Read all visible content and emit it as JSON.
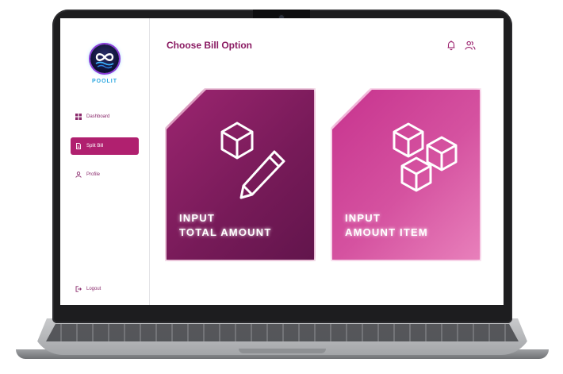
{
  "app": {
    "logo_text": "POOLIT",
    "page_title": "Choose Bill Option"
  },
  "sidebar": {
    "items": [
      {
        "label": "Dashboard",
        "icon": "dashboard-icon"
      },
      {
        "label": "Split Bill",
        "icon": "document-icon",
        "active": true
      },
      {
        "label": "Profile",
        "icon": "user-icon"
      }
    ],
    "logout_label": "Logout"
  },
  "header": {
    "icons": [
      "bell-icon",
      "users-icon"
    ]
  },
  "cards": [
    {
      "line1": "INPUT",
      "line2": "TOTAL AMOUNT",
      "icon": "box-pencil-icon"
    },
    {
      "line1": "INPUT",
      "line2": "AMOUNT ITEM",
      "icon": "boxes-icon"
    }
  ],
  "colors": {
    "accent": "#b0206f",
    "title": "#8a1a62",
    "card1": "#761a58",
    "card2": "#d552a0"
  }
}
